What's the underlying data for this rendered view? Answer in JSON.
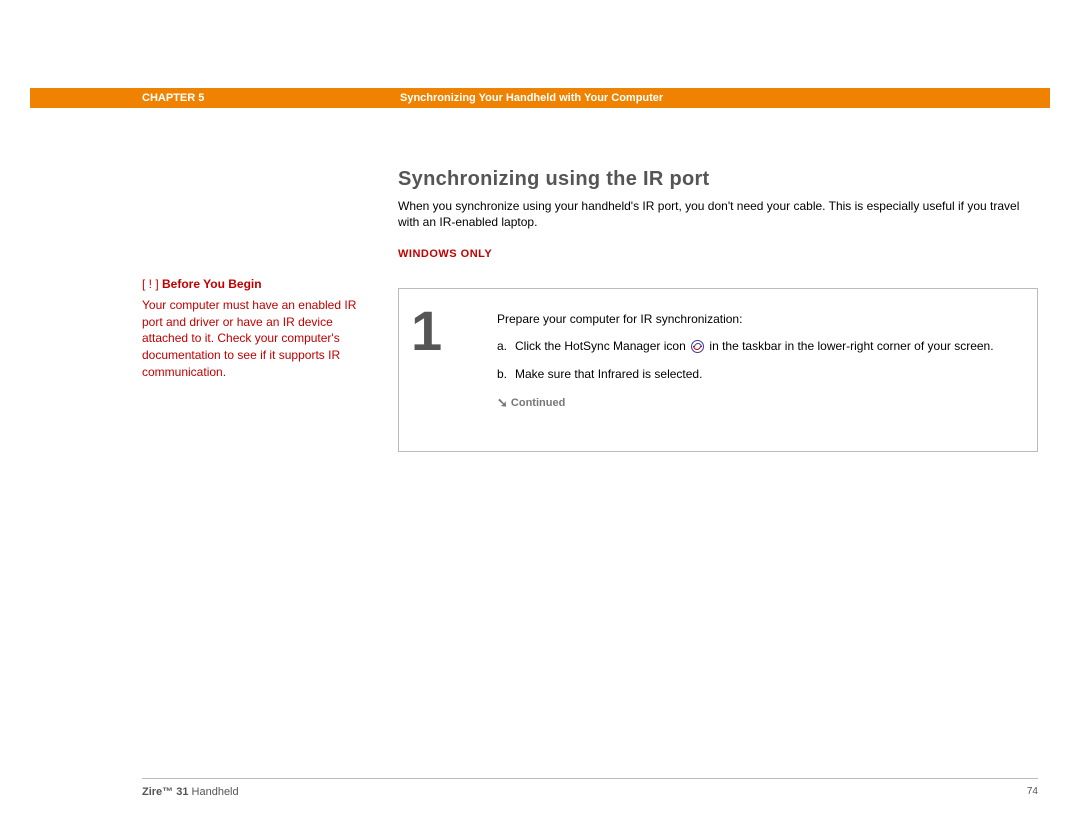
{
  "header": {
    "chapter": "CHAPTER 5",
    "title": "Synchronizing Your Handheld with Your Computer"
  },
  "section": {
    "heading": "Synchronizing using the IR port",
    "intro": "When you synchronize using your handheld's IR port, you don't need your cable. This is especially useful if you travel with an IR-enabled laptop.",
    "windows_only": "WINDOWS ONLY"
  },
  "sidebar": {
    "title_prefix": "[ ! ]",
    "title": "Before You Begin",
    "body": "Your computer must have an enabled IR port and driver or have an IR device attached to it. Check your computer's documentation to see if it supports IR communication."
  },
  "step": {
    "number": "1",
    "lead": "Prepare your computer for IR synchronization:",
    "items": [
      {
        "label": "a.",
        "pre": "Click the HotSync Manager icon ",
        "post": " in the taskbar in the lower-right corner of your screen."
      },
      {
        "label": "b.",
        "pre": "Make sure that Infrared is selected.",
        "post": ""
      }
    ],
    "continued": "Continued"
  },
  "footer": {
    "product_bold": "Zire™ 31",
    "product_rest": " Handheld",
    "page": "74"
  }
}
